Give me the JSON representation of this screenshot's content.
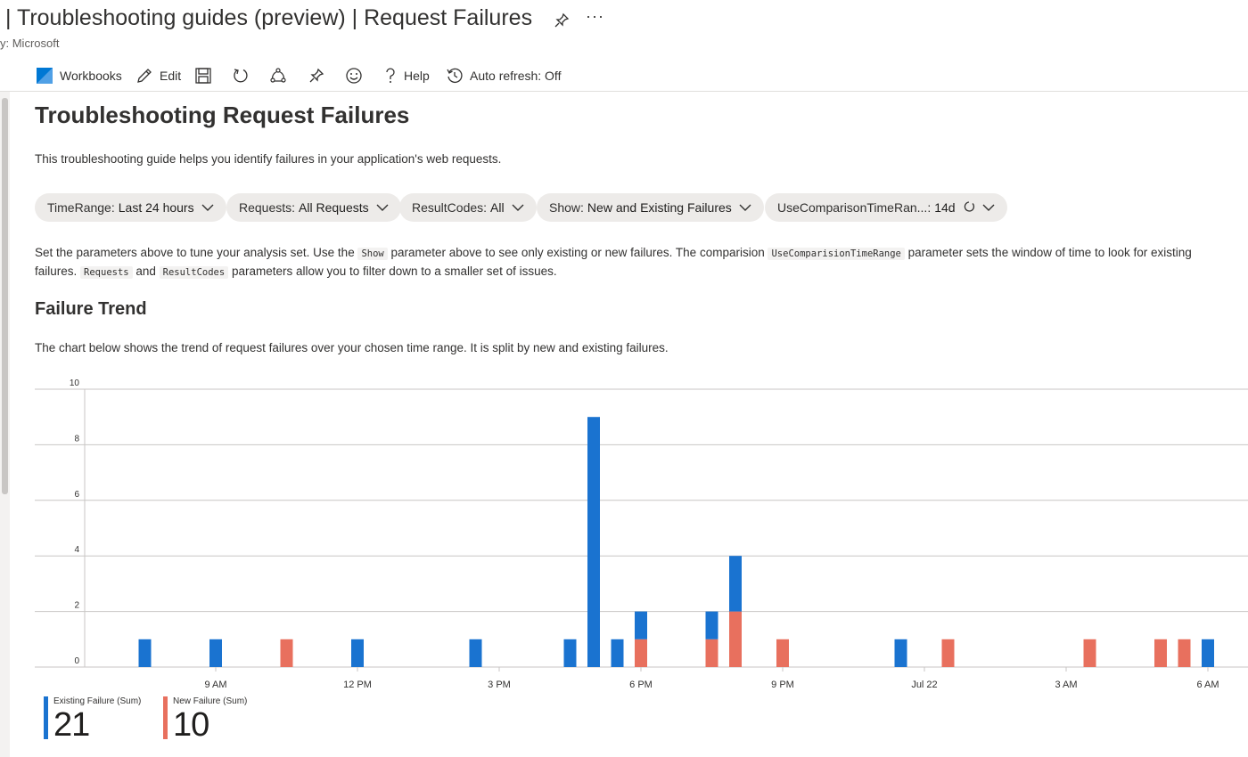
{
  "header": {
    "title": "| Troubleshooting guides (preview) | Request Failures",
    "publisher": "y: Microsoft",
    "more_label": "···"
  },
  "toolbar": {
    "workbooks_label": "Workbooks",
    "edit_label": "Edit",
    "help_label": "Help",
    "auto_refresh_label": "Auto refresh: Off"
  },
  "page": {
    "heading": "Troubleshooting Request Failures",
    "intro": "This troubleshooting guide helps you identify failures in your application's web requests.",
    "desc_1": "Set the parameters above to tune your analysis set. Use the ",
    "desc_code_1": "Show",
    "desc_2": " parameter above to see only existing or new failures. The comparision ",
    "desc_code_2": "UseComparisionTimeRange",
    "desc_3": " parameter sets the window of time to look for existing failures. ",
    "desc_code_3": "Requests",
    "desc_4": " and ",
    "desc_code_4": "ResultCodes",
    "desc_5": " parameters allow you to filter down to a smaller set of issues.",
    "trend_heading": "Failure Trend",
    "trend_desc": "The chart below shows the trend of request failures over your chosen time range. It is split by new and existing failures."
  },
  "parameters": [
    {
      "name": "TimeRange:",
      "value": "Last 24 hours"
    },
    {
      "name": "Requests:",
      "value": "All Requests"
    },
    {
      "name": "ResultCodes:",
      "value": "All"
    },
    {
      "name": "Show:",
      "value": "New and Existing Failures"
    },
    {
      "name": "UseComparisonTimeRan...:",
      "value": "14d"
    }
  ],
  "colors": {
    "existing": "#1a73d0",
    "new": "#e8705e",
    "brand": "#0078d4"
  },
  "chart_data": {
    "type": "bar",
    "stacked": true,
    "x_unit": "hours from 9 AM",
    "ylim": [
      0,
      10
    ],
    "y_ticks": [
      0,
      2,
      4,
      6,
      8,
      10
    ],
    "x_ticks": [
      {
        "label": "9 AM",
        "x": 0
      },
      {
        "label": "12 PM",
        "x": 3
      },
      {
        "label": "3 PM",
        "x": 6
      },
      {
        "label": "6 PM",
        "x": 9
      },
      {
        "label": "9 PM",
        "x": 12
      },
      {
        "label": "Jul 22",
        "x": 15
      },
      {
        "label": "3 AM",
        "x": 18
      },
      {
        "label": "6 AM",
        "x": 21
      }
    ],
    "xlim": [
      -2.75,
      21.25
    ],
    "grid": true,
    "series": [
      {
        "name": "Existing Failure (Sum)",
        "color": "#1a73d0"
      },
      {
        "name": "New Failure (Sum)",
        "color": "#e8705e"
      }
    ],
    "bars": [
      {
        "x": -1.5,
        "existing": 1,
        "new": 0
      },
      {
        "x": 0.0,
        "existing": 1,
        "new": 0
      },
      {
        "x": 1.5,
        "existing": 0,
        "new": 1
      },
      {
        "x": 3.0,
        "existing": 1,
        "new": 0
      },
      {
        "x": 5.5,
        "existing": 1,
        "new": 0
      },
      {
        "x": 7.5,
        "existing": 1,
        "new": 0
      },
      {
        "x": 8.0,
        "existing": 9,
        "new": 0
      },
      {
        "x": 8.5,
        "existing": 1,
        "new": 0
      },
      {
        "x": 9.0,
        "existing": 1,
        "new": 1
      },
      {
        "x": 10.5,
        "existing": 1,
        "new": 1
      },
      {
        "x": 11.0,
        "existing": 2,
        "new": 2
      },
      {
        "x": 12.0,
        "existing": 0,
        "new": 1
      },
      {
        "x": 14.5,
        "existing": 1,
        "new": 0
      },
      {
        "x": 15.5,
        "existing": 0,
        "new": 1
      },
      {
        "x": 18.5,
        "existing": 0,
        "new": 1
      },
      {
        "x": 20.0,
        "existing": 0,
        "new": 1
      },
      {
        "x": 20.5,
        "existing": 0,
        "new": 1
      },
      {
        "x": 21.0,
        "existing": 1,
        "new": 0
      }
    ],
    "legend": [
      {
        "name": "Existing Failure (Sum)",
        "total": "21",
        "color": "#1a73d0"
      },
      {
        "name": "New Failure (Sum)",
        "total": "10",
        "color": "#e8705e"
      }
    ]
  }
}
